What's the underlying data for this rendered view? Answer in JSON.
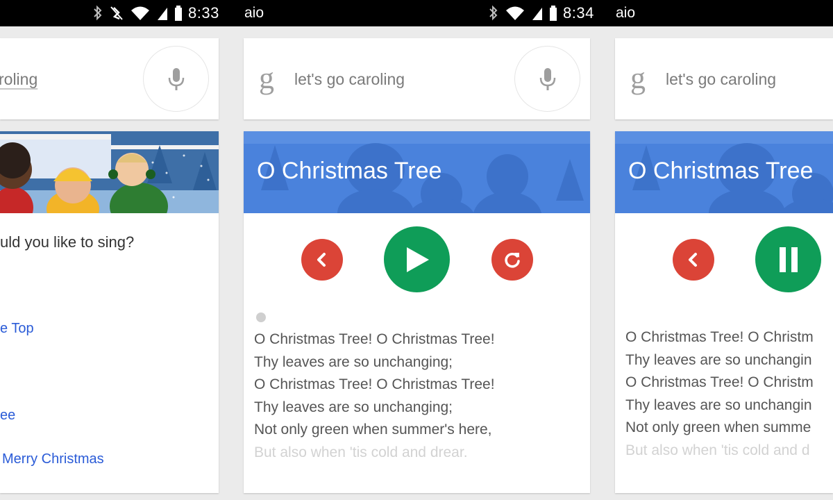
{
  "status_bar": {
    "left": {
      "time": "8:33",
      "app": "aio"
    },
    "right": {
      "time": "8:34",
      "app": "aio"
    }
  },
  "panels": [
    {
      "search": {
        "query_visible": "roling"
      },
      "question": "uld you like to sing?",
      "song_links": [
        "e Top",
        "ee",
        "Merry Christmas"
      ]
    },
    {
      "search": {
        "query": "let's go caroling"
      },
      "song_title": "O Christmas Tree",
      "controls": {
        "back": "chevron-left-icon",
        "play": "play-icon",
        "replay": "replay-icon"
      },
      "lyrics": [
        "O Christmas Tree! O Christmas Tree!",
        "Thy leaves are so unchanging;",
        "O Christmas Tree! O Christmas Tree!",
        "Thy leaves are so unchanging;",
        "Not only green when summer's here,",
        "But also when 'tis cold and drear."
      ]
    },
    {
      "search": {
        "query": "let's go caroling"
      },
      "song_title": "O Christmas Tree",
      "controls": {
        "back": "chevron-left-icon",
        "pause": "pause-icon"
      },
      "lyrics": [
        "O Christmas Tree! O Christm",
        "Thy leaves are so unchangin",
        "O Christmas Tree! O Christm",
        "Thy leaves are so unchangin",
        "Not only green when summe",
        "But also when 'tis cold and d"
      ]
    }
  ],
  "colors": {
    "banner_blue": "#4a82dc",
    "red_button": "#db4437",
    "green_button": "#0f9d58",
    "link": "#2a5bd7"
  }
}
